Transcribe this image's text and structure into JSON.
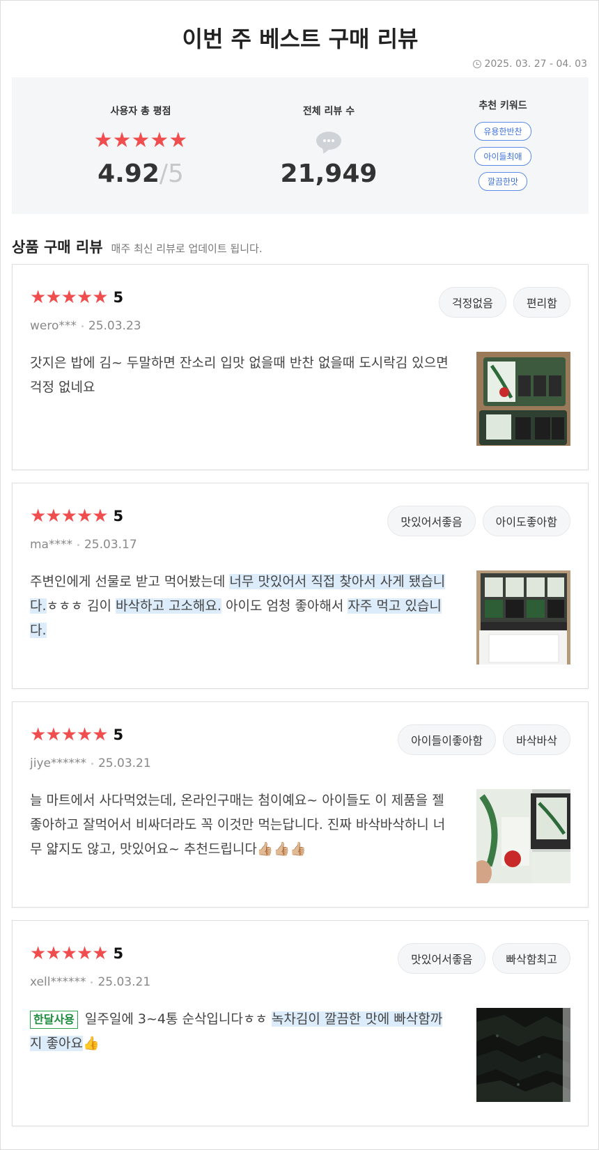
{
  "header": {
    "title": "이번 주 베스트 구매 리뷰",
    "date_range": "2025. 03. 27 - 04. 03"
  },
  "summary": {
    "rating_label": "사용자 총 평점",
    "rating_stars": "★★★★★",
    "rating_value": "4.92",
    "rating_max": "/5",
    "count_label": "전체 리뷰 수",
    "count_value": "21,949",
    "keywords_label": "추천 키워드",
    "keywords": [
      "유용한반찬",
      "아이들최애",
      "깔끔한맛"
    ]
  },
  "section": {
    "title": "상품 구매 리뷰",
    "subtitle": "매주 최신 리뷰로 업데이트 됩니다."
  },
  "reviews": [
    {
      "stars": "★★★★★",
      "score": "5",
      "user": "wero***",
      "date": "25.03.23",
      "tags": [
        "걱정없음",
        "편리함"
      ],
      "segments": [
        {
          "text": "갓지은 밥에 김~ 두말하면 잔소리 입맛 없을때 반찬 없을때 도시락김 있으면 걱정 없네요",
          "hl": false
        }
      ],
      "badge": ""
    },
    {
      "stars": "★★★★★",
      "score": "5",
      "user": "ma****",
      "date": "25.03.17",
      "tags": [
        "맛있어서좋음",
        "아이도좋아함"
      ],
      "segments": [
        {
          "text": "주변인에게 선물로 받고 먹어봤는데 ",
          "hl": false
        },
        {
          "text": "너무 맛있어서 직접 찾아서 사게 됐습니다.",
          "hl": true
        },
        {
          "text": "ㅎㅎㅎ 김이 ",
          "hl": false
        },
        {
          "text": "바삭하고 고소해요.",
          "hl": true
        },
        {
          "text": " 아이도 엄청 좋아해서 ",
          "hl": false
        },
        {
          "text": "자주 먹고 있습니다.",
          "hl": true
        }
      ],
      "badge": ""
    },
    {
      "stars": "★★★★★",
      "score": "5",
      "user": "jiye******",
      "date": "25.03.21",
      "tags": [
        "아이들이좋아함",
        "바삭바삭"
      ],
      "segments": [
        {
          "text": "늘 마트에서 사다먹었는데, 온라인구매는 첨이예요~ 아이들도 이 제품을 젤 좋아하고 잘먹어서 비싸더라도 꼭 이것만 먹는답니다. 진짜 바삭바삭하니 너무 얇지도 않고, 맛있어요~ 추천드립니다👍🏼👍🏼👍🏼",
          "hl": false
        }
      ],
      "badge": ""
    },
    {
      "stars": "★★★★★",
      "score": "5",
      "user": "xell******",
      "date": "25.03.21",
      "tags": [
        "맛있어서좋음",
        "빠삭함최고"
      ],
      "segments": [
        {
          "text": "일주일에 3~4통 순삭입니다ㅎㅎ ",
          "hl": false
        },
        {
          "text": "녹차김이 깔끔한 맛에 빠삭함까지 좋아요",
          "hl": true
        },
        {
          "text": "👍",
          "hl": false
        }
      ],
      "badge": "한달사용"
    }
  ],
  "colors": {
    "star": "#f04e4e",
    "highlight": "#dcecfb",
    "keyword": "#3b6fd8",
    "badge": "#1b8a3a"
  }
}
